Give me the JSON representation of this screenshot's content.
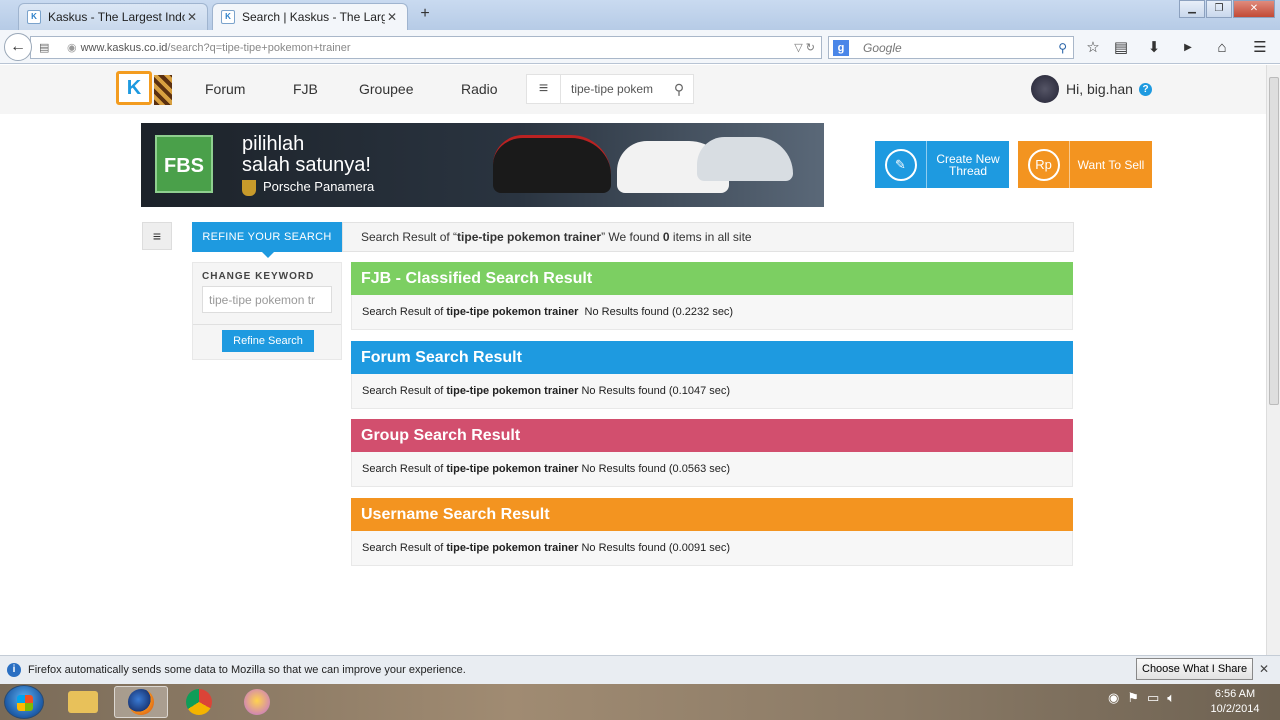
{
  "browser": {
    "tabs": [
      {
        "title": "Kaskus - The Largest Indon...",
        "active": false
      },
      {
        "title": "Search | Kaskus - The Large...",
        "active": true
      }
    ],
    "url_domain": "www.kaskus.co.id",
    "url_path": "/search?q=tipe-tipe+pokemon+trainer",
    "search_placeholder": "Google"
  },
  "site": {
    "nav": [
      "Forum",
      "FJB",
      "Groupee",
      "Radio"
    ],
    "search_value": "tipe-tipe pokem",
    "greeting": "Hi, big.han",
    "help_icon": "?"
  },
  "banner": {
    "brand": "FBS",
    "line1": "pilihlah",
    "line2": "salah satunya!",
    "line3": "Porsche Panamera"
  },
  "actions": {
    "create_thread": "Create New Thread",
    "want_to_sell": "Want To Sell",
    "want_to_sell_icon": "Rp"
  },
  "refine": {
    "tab_label": "REFINE YOUR SEARCH",
    "caption": "CHANGE KEYWORD",
    "keyword_value": "tipe-tipe pokemon tr",
    "button_label": "Refine Search"
  },
  "summary": {
    "prefix": "Search Result of “",
    "query": "tipe-tipe pokemon trainer",
    "mid": "” We found ",
    "count": "0",
    "suffix": " items in all site"
  },
  "sections": [
    {
      "title": "FJB - Classified Search Result",
      "color": "#7ccf62",
      "prefix": "Search Result of ",
      "query": "tipe-tipe pokemon trainer",
      "result": "  No Results found (0.2232 sec)"
    },
    {
      "title": "Forum Search Result",
      "color": "#1e9ae0",
      "prefix": "Search Result of ",
      "query": "tipe-tipe pokemon trainer",
      "result": " No Results found (0.1047 sec)"
    },
    {
      "title": "Group Search Result",
      "color": "#d24f6e",
      "prefix": "Search Result of ",
      "query": "tipe-tipe pokemon trainer",
      "result": " No Results found (0.0563 sec)"
    },
    {
      "title": "Username Search Result",
      "color": "#f39420",
      "prefix": "Search Result of ",
      "query": "tipe-tipe pokemon trainer",
      "result": " No Results found (0.0091 sec)"
    }
  ],
  "notification": {
    "text": "Firefox automatically sends some data to Mozilla so that we can improve your experience.",
    "button": "Choose What I Share"
  },
  "taskbar": {
    "time": "6:56 AM",
    "date": "10/2/2014"
  }
}
